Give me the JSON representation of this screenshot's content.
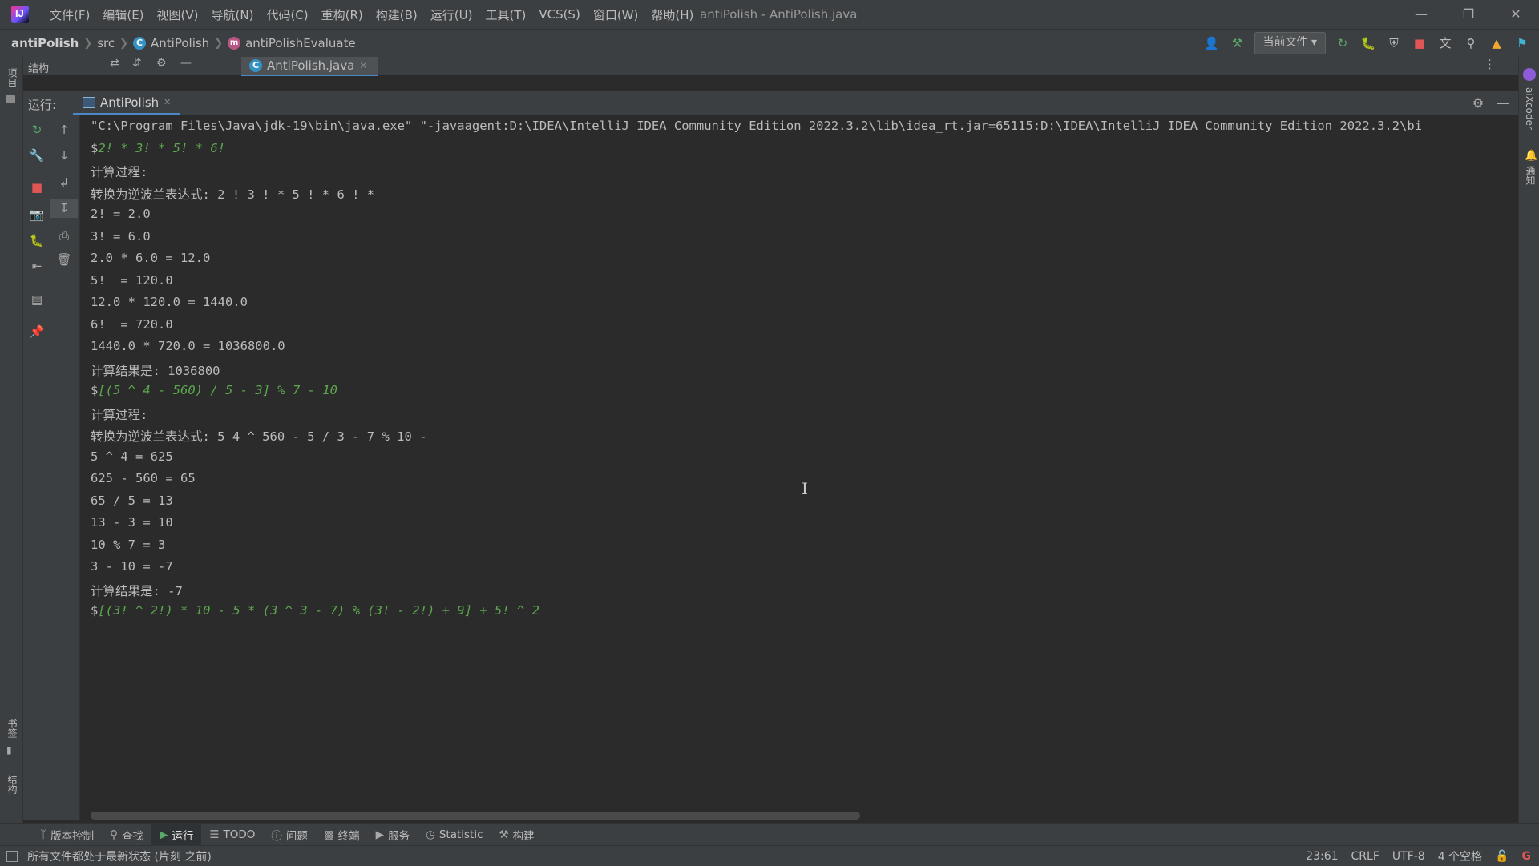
{
  "window": {
    "title": "antiPolish - AntiPolish.java",
    "menu": [
      "文件(F)",
      "编辑(E)",
      "视图(V)",
      "导航(N)",
      "代码(C)",
      "重构(R)",
      "构建(B)",
      "运行(U)",
      "工具(T)",
      "VCS(S)",
      "窗口(W)",
      "帮助(H)"
    ]
  },
  "breadcrumb": {
    "project": "antiPolish",
    "folder": "src",
    "class": "AntiPolish",
    "method": "antiPolishEvaluate"
  },
  "toolbar": {
    "run_config": "当前文件"
  },
  "left_strip": {
    "project_label": "项目",
    "bookmarks_label": "书签",
    "structure_label": "结构"
  },
  "right_strip": {
    "coder_label": "aiXcoder",
    "notifications_label": "通知"
  },
  "structure": {
    "label": "结构"
  },
  "editor_tab": {
    "label": "AntiPolish.java"
  },
  "run_panel": {
    "label": "运行:",
    "tab": "AntiPolish"
  },
  "console": {
    "lines": [
      {
        "type": "out",
        "text": "\"C:\\Program Files\\Java\\jdk-19\\bin\\java.exe\" \"-javaagent:D:\\IDEA\\IntelliJ IDEA Community Edition 2022.3.2\\lib\\idea_rt.jar=65115:D:\\IDEA\\IntelliJ IDEA Community Edition 2022.3.2\\bi"
      },
      {
        "type": "in",
        "prompt": "$",
        "text": "2! * 3! * 5! * 6!"
      },
      {
        "type": "out",
        "text": "计算过程:"
      },
      {
        "type": "out",
        "text": "转换为逆波兰表达式: 2 ! 3 ! * 5 ! * 6 ! *"
      },
      {
        "type": "out",
        "text": "2! = 2.0"
      },
      {
        "type": "out",
        "text": "3! = 6.0"
      },
      {
        "type": "out",
        "text": "2.0 * 6.0 = 12.0"
      },
      {
        "type": "out",
        "text": "5!  = 120.0"
      },
      {
        "type": "out",
        "text": "12.0 * 120.0 = 1440.0"
      },
      {
        "type": "out",
        "text": "6!  = 720.0"
      },
      {
        "type": "out",
        "text": "1440.0 * 720.0 = 1036800.0"
      },
      {
        "type": "out",
        "text": "计算结果是: 1036800"
      },
      {
        "type": "in",
        "prompt": "$",
        "text": "[(5 ^ 4 - 560) / 5 - 3] % 7 - 10"
      },
      {
        "type": "out",
        "text": "计算过程:"
      },
      {
        "type": "out",
        "text": "转换为逆波兰表达式: 5 4 ^ 560 - 5 / 3 - 7 % 10 -"
      },
      {
        "type": "out",
        "text": "5 ^ 4 = 625"
      },
      {
        "type": "out",
        "text": "625 - 560 = 65"
      },
      {
        "type": "out",
        "text": "65 / 5 = 13"
      },
      {
        "type": "out",
        "text": "13 - 3 = 10"
      },
      {
        "type": "out",
        "text": "10 % 7 = 3"
      },
      {
        "type": "out",
        "text": "3 - 10 = -7"
      },
      {
        "type": "out",
        "text": "计算结果是: -7"
      },
      {
        "type": "in",
        "prompt": "$",
        "text": "[(3! ^ 2!) * 10 - 5 * (3 ^ 3 - 7) % (3! - 2!) + 9] + 5! ^ 2"
      }
    ]
  },
  "bottom_tabs": [
    "版本控制",
    "查找",
    "运行",
    "TODO",
    "问题",
    "终端",
    "服务",
    "Statistic",
    "构建"
  ],
  "bottom_active": "运行",
  "status": {
    "message": "所有文件都处于最新状态 (片刻 之前)",
    "position": "23:61",
    "line_sep": "CRLF",
    "encoding": "UTF-8",
    "indent": "4 个空格"
  },
  "colors": {
    "accent": "#4a88c7",
    "input_text": "#5da84f",
    "background": "#2b2b2b",
    "panel": "#3c3f41"
  }
}
